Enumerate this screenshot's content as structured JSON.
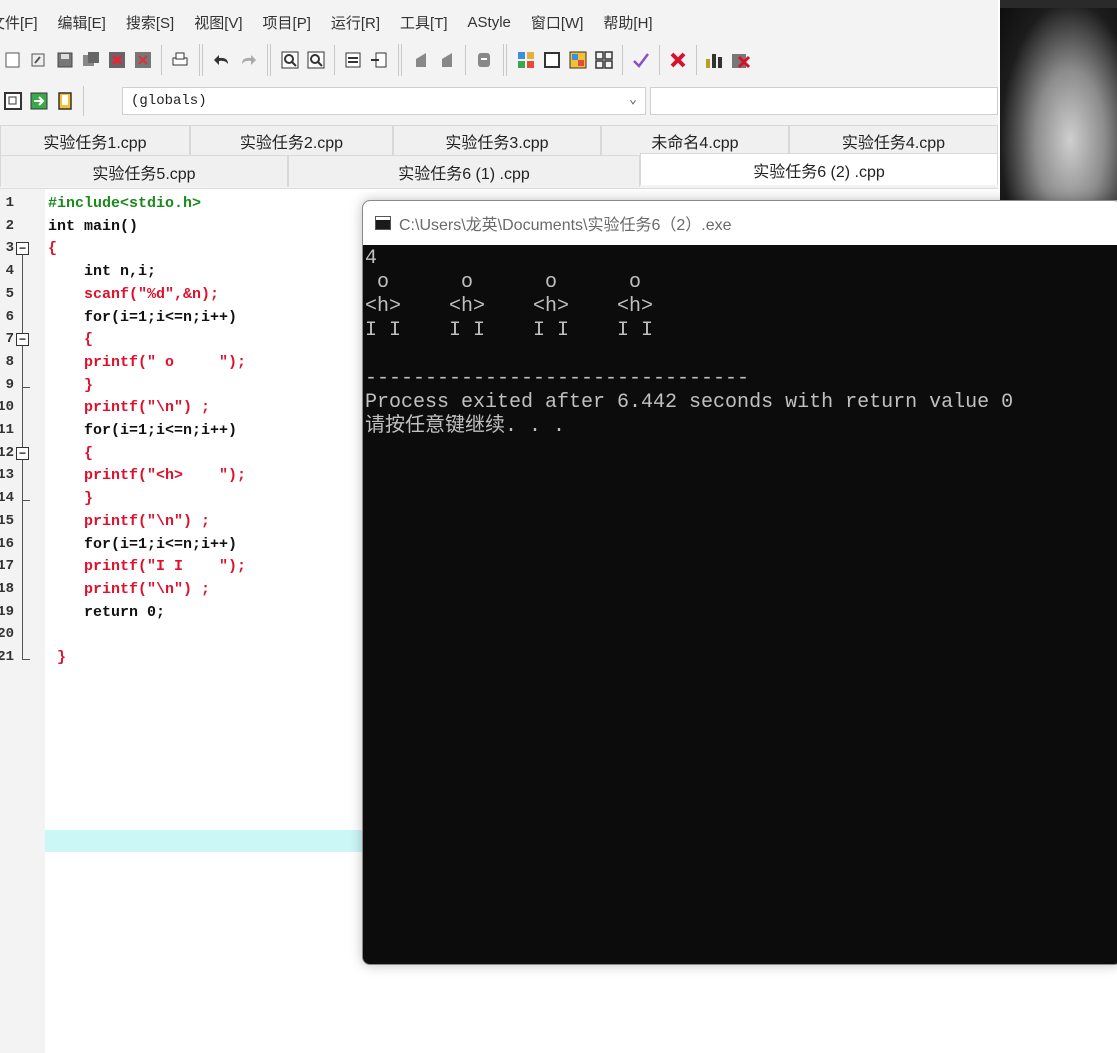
{
  "menu": [
    "文件[F]",
    "编辑[E]",
    "搜索[S]",
    "视图[V]",
    "项目[P]",
    "运行[R]",
    "工具[T]",
    "AStyle",
    "窗口[W]",
    "帮助[H]"
  ],
  "scope": {
    "value": "(globals)",
    "chevron": "⌄"
  },
  "tabs_row1": [
    "实验任务1.cpp",
    "实验任务2.cpp",
    "实验任务3.cpp",
    "未命名4.cpp",
    "实验任务4.cpp"
  ],
  "tabs_row2": [
    "实验任务5.cpp",
    "实验任务6 (1) .cpp",
    "实验任务6 (2) .cpp"
  ],
  "active_tab": "实验任务6 (2) .cpp",
  "line_numbers": [
    "1",
    "2",
    "3",
    "4",
    "5",
    "6",
    "7",
    "8",
    "9",
    "10",
    "11",
    "12",
    "13",
    "14",
    "15",
    "16",
    "17",
    "18",
    "19",
    "20",
    "21"
  ],
  "code": [
    "#include<stdio.h>",
    "int main()",
    "{",
    "    int n,i;",
    "    scanf(\"%d\",&n);",
    "    for(i=1;i<=n;i++)",
    "    {",
    "    printf(\" o     \");",
    "    }",
    "    printf(\"\\n\") ;",
    "    for(i=1;i<=n;i++)",
    "    {",
    "    printf(\"<h>    \");",
    "    }",
    "    printf(\"\\n\") ;",
    "    for(i=1;i<=n;i++)",
    "    printf(\"I I    \");",
    "    printf(\"\\n\") ;",
    "    return 0;",
    "",
    " }"
  ],
  "console": {
    "title": "C:\\Users\\龙英\\Documents\\实验任务6（2）.exe",
    "lines": [
      "4",
      " o      o      o      o",
      "<h>    <h>    <h>    <h>",
      "I I    I I    I I    I I",
      "",
      "--------------------------------",
      "Process exited after 6.442 seconds with return value 0",
      "请按任意键继续. . ."
    ]
  },
  "colors": {
    "string": "#e0102a",
    "preprocessor": "#1a8a1a",
    "current_line": "#ccf7f7",
    "console_bg": "#0c0c0c",
    "console_fg": "#c0c0c0"
  },
  "toolbar_icons": [
    "new-icon",
    "open-icon",
    "save-icon",
    "save-all-icon",
    "close-icon",
    "close-all-icon",
    "print-icon",
    "undo-icon",
    "redo-icon",
    "find-icon",
    "replace-icon",
    "indent-icon",
    "unindent-icon",
    "bookmark-icon",
    "bookmark-prev-icon",
    "comment-icon",
    "compile-icon",
    "run-icon",
    "compile-run-icon",
    "rebuild-icon",
    "syntax-check-icon",
    "stop-icon",
    "chart-icon",
    "delete-icon"
  ]
}
